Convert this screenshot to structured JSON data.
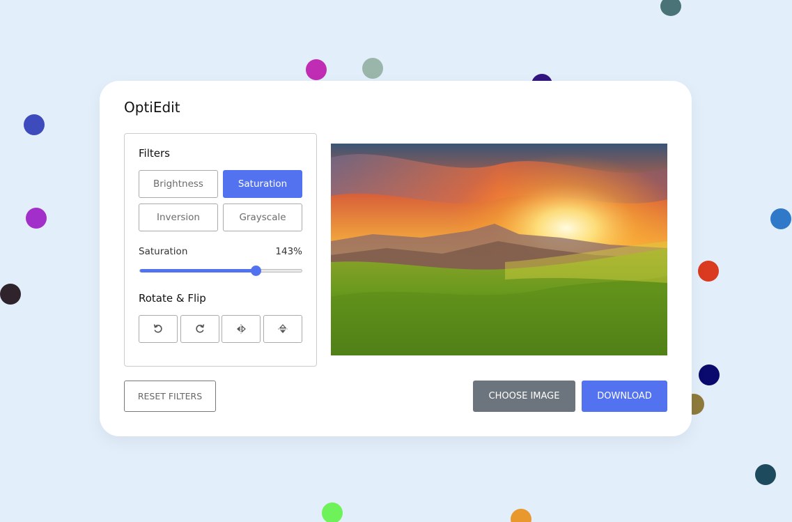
{
  "app": {
    "title": "OptiEdit"
  },
  "filters": {
    "heading": "Filters",
    "buttons": [
      {
        "label": "Brightness",
        "active": false
      },
      {
        "label": "Saturation",
        "active": true
      },
      {
        "label": "Inversion",
        "active": false
      },
      {
        "label": "Grayscale",
        "active": false
      }
    ]
  },
  "slider": {
    "label": "Saturation",
    "value_text": "143%",
    "value": 143,
    "max": 200
  },
  "rotate": {
    "heading": "Rotate & Flip",
    "buttons": [
      "rotate-left-icon",
      "rotate-right-icon",
      "flip-horizontal-icon",
      "flip-vertical-icon"
    ]
  },
  "actions": {
    "reset_label": "RESET FILTERS",
    "choose_label": "CHOOSE IMAGE",
    "download_label": "DOWNLOAD"
  },
  "colors": {
    "accent": "#5372f0",
    "secondary": "#6c757d",
    "background": "#e3eefb"
  }
}
